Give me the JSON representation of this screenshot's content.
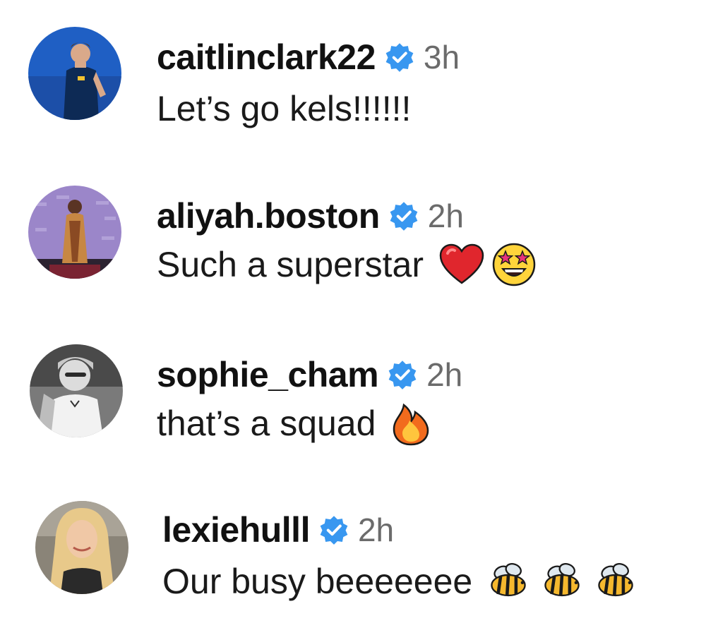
{
  "comments": [
    {
      "username": "caitlinclark22",
      "verified": true,
      "time": "3h",
      "text": "Let’s go kels!!!!!!",
      "avatar_icon": "avatar-player-blue",
      "emojis": []
    },
    {
      "username": "aliyah.boston",
      "verified": true,
      "time": "2h",
      "text": "Such a superstar",
      "avatar_icon": "avatar-red-carpet",
      "emojis": [
        "red-heart-icon",
        "star-struck-icon"
      ]
    },
    {
      "username": "sophie_cham",
      "verified": true,
      "time": "2h",
      "text": "that’s a squad",
      "avatar_icon": "avatar-bw-selfie",
      "emojis": [
        "fire-icon"
      ]
    },
    {
      "username": "lexiehulll",
      "verified": true,
      "time": "2h",
      "text": "Our busy beeeeeee",
      "avatar_icon": "avatar-blonde-selfie",
      "emojis": [
        "bee-icon",
        "bee-icon",
        "bee-icon"
      ]
    }
  ],
  "colors": {
    "verified_badge": "#3897f0",
    "time_text": "#6b6b6b",
    "username_text": "#111111"
  }
}
